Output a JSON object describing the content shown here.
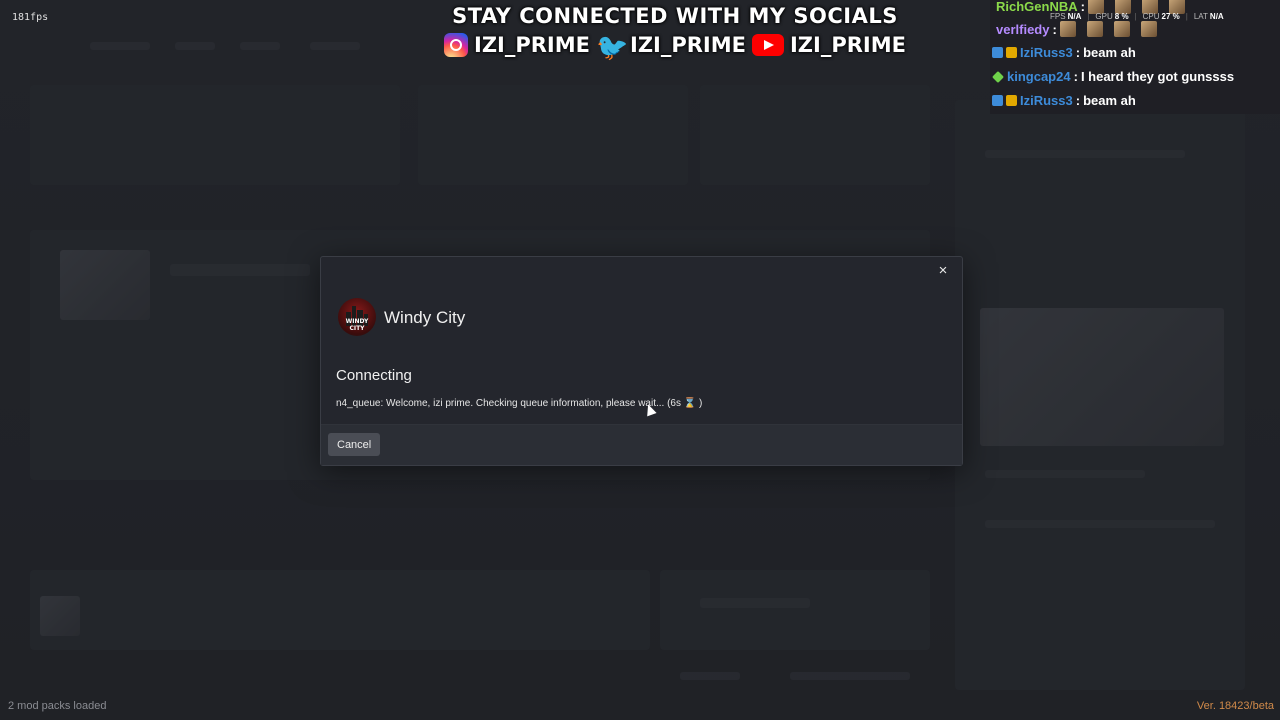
{
  "fps": {
    "label": "181fps"
  },
  "socials": {
    "headline": "STAY CONNECTED WITH MY SOCIALS",
    "instagram": "IZI_PRIME",
    "twitter": "IZI_PRIME",
    "youtube": "IZI_PRIME"
  },
  "chat": {
    "messages": [
      {
        "user": "RichGenNBA",
        "text": "",
        "user_color": "#8bd94a"
      },
      {
        "user": "verlfiedy",
        "text": "",
        "user_color": "#b58bff"
      },
      {
        "user": "IziRuss3",
        "text": "beam ah",
        "user_color": "#3d8bd9"
      },
      {
        "user": "kingcap24",
        "text": "I heard they got gunssss",
        "user_color": "#3d8bd9"
      },
      {
        "user": "IziRuss3",
        "text": "beam ah",
        "user_color": "#3d8bd9"
      }
    ]
  },
  "perf": {
    "fps_label": "FPS",
    "fps_value": "N/A",
    "gpu_label": "GPU",
    "gpu_value": "8 %",
    "cpu_label": "CPU",
    "cpu_value": "27 %",
    "lat_label": "LAT",
    "lat_value": "N/A"
  },
  "modal": {
    "close_icon": "×",
    "server_logo_text": "WINDY CITY",
    "server_name": "Windy City",
    "status_title": "Connecting",
    "status_message": "n4_queue: Welcome, izi prime. Checking queue information, please wait... (6s",
    "hourglass": "⌛",
    "status_suffix": ")",
    "cancel_label": "Cancel"
  },
  "footer": {
    "left": "2 mod packs loaded",
    "right": "Ver. 18423/beta"
  },
  "colors": {
    "accent_orange": "#d08a4a",
    "modal_bg": "#24262d"
  }
}
